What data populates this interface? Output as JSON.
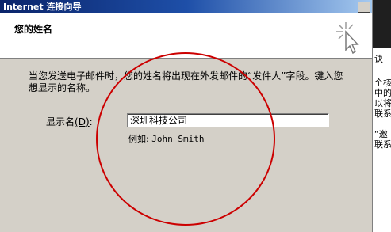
{
  "window": {
    "title": "Internet 连接向导"
  },
  "header": {
    "title": "您的姓名"
  },
  "main": {
    "description": "当您发送电子邮件时，您的姓名将出现在外发邮件的“发件人”字段。键入您想显示的名称。",
    "display_name": {
      "label_prefix": "显示名",
      "label_key": "(D)",
      "label_suffix": ":",
      "value": "深圳科技公司"
    },
    "example_prefix": "例如:",
    "example_value": "John Smith"
  },
  "background_window": {
    "fragments": [
      "诀",
      "个核",
      "中的",
      "以将",
      "联系",
      "“邀",
      "联系"
    ]
  },
  "colors": {
    "title_bar": "#0a246a",
    "annotation_circle": "#cc0000",
    "dialog_face": "#d4d0c8"
  }
}
